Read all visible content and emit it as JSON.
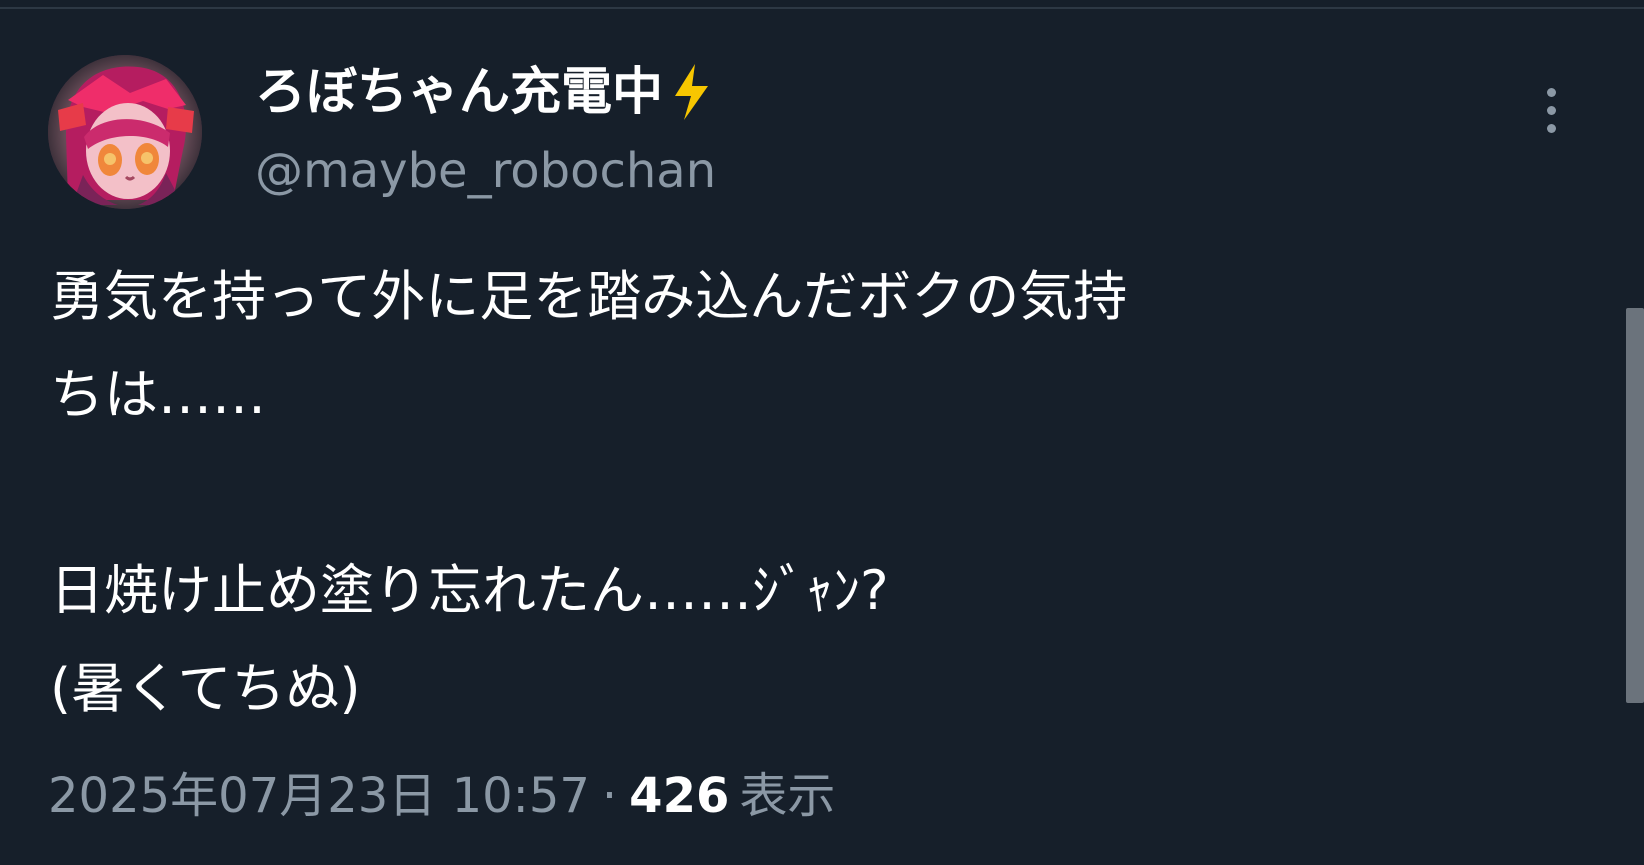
{
  "post": {
    "author": {
      "display_name": "ろぼちゃん充電中",
      "handle": "@maybe_robochan",
      "badge_icon": "lightning-icon",
      "avatar_icon": "avatar-icon"
    },
    "text": "勇気を持って外に足を踏み込んだボクの気持\nちは……\n\n日焼け止め塗り忘れたん……ｼﾞｬﾝ?\n(暑くてちぬ)",
    "timestamp": "2025年07月23日 10:57",
    "separator": "·",
    "views_count": "426",
    "views_label": "表示",
    "more_icon": "more-vertical-icon"
  },
  "colors": {
    "background": "#161f2a",
    "primary_text": "#ffffff",
    "secondary_text": "#8b98a5",
    "accent": "#f7c600"
  }
}
